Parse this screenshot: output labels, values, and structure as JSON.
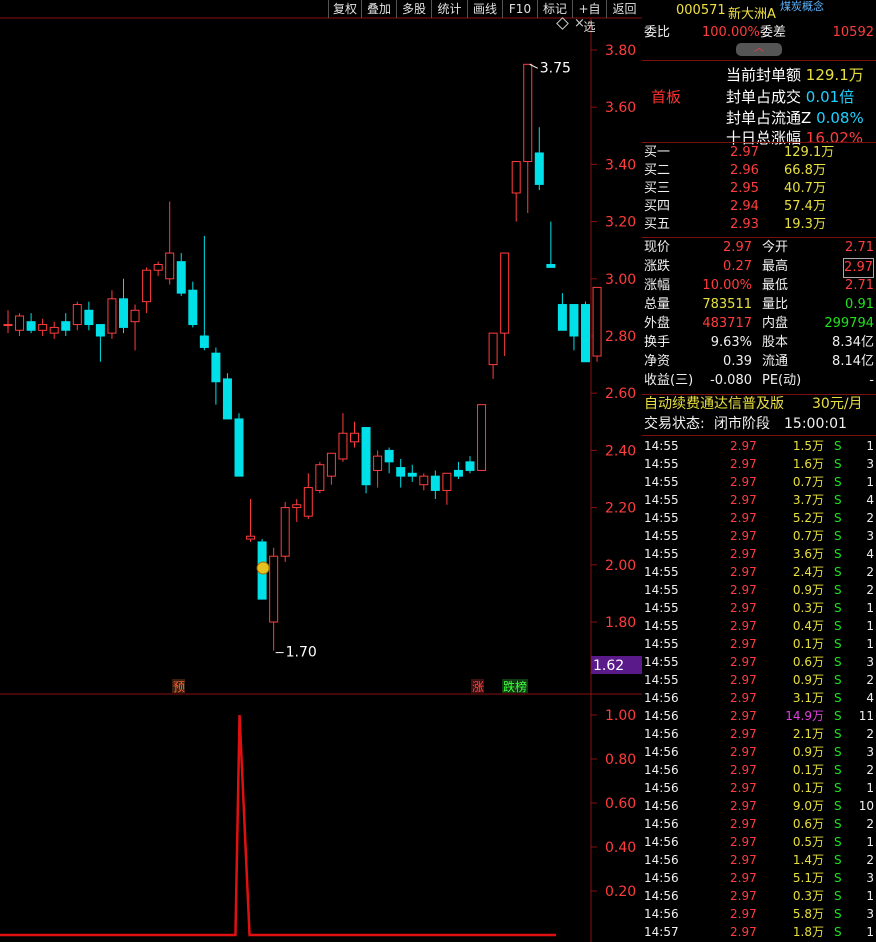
{
  "toolbar": {
    "buttons": [
      "复权",
      "叠加",
      "多股",
      "统计",
      "画线",
      "F10",
      "标记",
      "+自选",
      "返回"
    ]
  },
  "price_axis": {
    "labels": [
      "3.80",
      "3.60",
      "3.40",
      "3.20",
      "3.00",
      "2.80",
      "2.60",
      "2.40",
      "2.20",
      "2.00",
      "1.80"
    ],
    "current_marker": "1.62"
  },
  "annotations": {
    "high_label": "3.75",
    "low_label": "1.70",
    "marker_yu": "预",
    "marker_zhang": "涨",
    "marker_longhubang": "跌榜"
  },
  "indicator_axis": {
    "labels": [
      "1.00",
      "0.80",
      "0.60",
      "0.40",
      "0.20"
    ]
  },
  "chart_data": [
    {
      "type": "candlestick",
      "title": "",
      "ylim": [
        1.62,
        3.85
      ],
      "x_unit": "trading day index",
      "candles": [
        {
          "o": 2.84,
          "h": 2.89,
          "l": 2.81,
          "c": 2.84
        },
        {
          "o": 2.82,
          "h": 2.88,
          "l": 2.8,
          "c": 2.87
        },
        {
          "o": 2.85,
          "h": 2.88,
          "l": 2.81,
          "c": 2.82
        },
        {
          "o": 2.82,
          "h": 2.86,
          "l": 2.8,
          "c": 2.84
        },
        {
          "o": 2.81,
          "h": 2.85,
          "l": 2.79,
          "c": 2.83
        },
        {
          "o": 2.85,
          "h": 2.88,
          "l": 2.8,
          "c": 2.82
        },
        {
          "o": 2.84,
          "h": 2.92,
          "l": 2.82,
          "c": 2.91
        },
        {
          "o": 2.89,
          "h": 2.92,
          "l": 2.82,
          "c": 2.84
        },
        {
          "o": 2.84,
          "h": 2.84,
          "l": 2.71,
          "c": 2.8
        },
        {
          "o": 2.81,
          "h": 2.96,
          "l": 2.79,
          "c": 2.93
        },
        {
          "o": 2.93,
          "h": 3.0,
          "l": 2.81,
          "c": 2.83
        },
        {
          "o": 2.85,
          "h": 2.91,
          "l": 2.75,
          "c": 2.89
        },
        {
          "o": 2.92,
          "h": 3.04,
          "l": 2.88,
          "c": 3.03
        },
        {
          "o": 3.03,
          "h": 3.06,
          "l": 3.01,
          "c": 3.05
        },
        {
          "o": 3.0,
          "h": 3.27,
          "l": 2.98,
          "c": 3.09
        },
        {
          "o": 3.06,
          "h": 3.09,
          "l": 2.94,
          "c": 2.95
        },
        {
          "o": 2.96,
          "h": 2.99,
          "l": 2.83,
          "c": 2.84
        },
        {
          "o": 2.8,
          "h": 3.15,
          "l": 2.75,
          "c": 2.76
        },
        {
          "o": 2.74,
          "h": 2.76,
          "l": 2.56,
          "c": 2.64
        },
        {
          "o": 2.65,
          "h": 2.67,
          "l": 2.53,
          "c": 2.51
        },
        {
          "o": 2.51,
          "h": 2.53,
          "l": 2.31,
          "c": 2.31
        },
        {
          "o": 2.09,
          "h": 2.23,
          "l": 2.08,
          "c": 2.1
        },
        {
          "o": 2.08,
          "h": 2.09,
          "l": 1.88,
          "c": 1.88
        },
        {
          "o": 1.8,
          "h": 2.06,
          "l": 1.7,
          "c": 2.03
        },
        {
          "o": 2.03,
          "h": 2.22,
          "l": 2.01,
          "c": 2.2
        },
        {
          "o": 2.2,
          "h": 2.23,
          "l": 2.15,
          "c": 2.21
        },
        {
          "o": 2.17,
          "h": 2.32,
          "l": 2.16,
          "c": 2.27
        },
        {
          "o": 2.26,
          "h": 2.36,
          "l": 2.25,
          "c": 2.35
        },
        {
          "o": 2.31,
          "h": 2.39,
          "l": 2.28,
          "c": 2.39
        },
        {
          "o": 2.37,
          "h": 2.53,
          "l": 2.36,
          "c": 2.46
        },
        {
          "o": 2.43,
          "h": 2.5,
          "l": 2.41,
          "c": 2.46
        },
        {
          "o": 2.48,
          "h": 2.48,
          "l": 2.25,
          "c": 2.28
        },
        {
          "o": 2.33,
          "h": 2.4,
          "l": 2.27,
          "c": 2.38
        },
        {
          "o": 2.4,
          "h": 2.41,
          "l": 2.32,
          "c": 2.36
        },
        {
          "o": 2.34,
          "h": 2.37,
          "l": 2.27,
          "c": 2.31
        },
        {
          "o": 2.32,
          "h": 2.35,
          "l": 2.29,
          "c": 2.31
        },
        {
          "o": 2.28,
          "h": 2.32,
          "l": 2.26,
          "c": 2.31
        },
        {
          "o": 2.31,
          "h": 2.33,
          "l": 2.23,
          "c": 2.26
        },
        {
          "o": 2.26,
          "h": 2.32,
          "l": 2.21,
          "c": 2.32
        },
        {
          "o": 2.33,
          "h": 2.36,
          "l": 2.3,
          "c": 2.31
        },
        {
          "o": 2.36,
          "h": 2.38,
          "l": 2.32,
          "c": 2.33
        },
        {
          "o": 2.33,
          "h": 2.56,
          "l": 2.33,
          "c": 2.56
        },
        {
          "o": 2.7,
          "h": 2.81,
          "l": 2.65,
          "c": 2.81
        },
        {
          "o": 2.81,
          "h": 3.09,
          "l": 2.73,
          "c": 3.09
        },
        {
          "o": 3.3,
          "h": 3.41,
          "l": 3.2,
          "c": 3.41
        },
        {
          "o": 3.41,
          "h": 3.75,
          "l": 3.23,
          "c": 3.75
        },
        {
          "o": 3.44,
          "h": 3.53,
          "l": 3.31,
          "c": 3.33
        },
        {
          "o": 3.05,
          "h": 3.2,
          "l": 3.04,
          "c": 3.04
        },
        {
          "o": 2.91,
          "h": 2.95,
          "l": 2.82,
          "c": 2.82
        },
        {
          "o": 2.91,
          "h": 2.91,
          "l": 2.75,
          "c": 2.8
        },
        {
          "o": 2.91,
          "h": 2.92,
          "l": 2.71,
          "c": 2.71
        },
        {
          "o": 2.73,
          "h": 2.97,
          "l": 2.71,
          "c": 2.97
        }
      ]
    },
    {
      "type": "line",
      "title": "",
      "ylim": [
        0,
        1.1
      ],
      "x_unit": "trading day index",
      "series": [
        {
          "name": "",
          "points": [
            [
              0,
              0
            ],
            [
              19,
              0
            ],
            [
              20,
              1.0
            ],
            [
              21,
              0
            ],
            [
              51,
              0
            ]
          ]
        }
      ]
    }
  ],
  "panel": {
    "code": "000571",
    "name": "新大洲A",
    "concept": "煤炭概念",
    "weibi_label": "委比",
    "weibi_value": "100.00%",
    "weicha_label": "委差",
    "weicha_value": "10592",
    "expand_icon": "chevron-up-icon",
    "first_board": "首板",
    "seal_amount_label": "当前封单额",
    "seal_amount_value": "129.1万",
    "seal_vs_turnover_label": "封单占成交",
    "seal_vs_turnover_value": "0.01倍",
    "seal_vs_float_label": "封单占流通Z",
    "seal_vs_float_value": "0.08%",
    "ten_day_label": "十日总涨幅",
    "ten_day_value": "16.02%",
    "bids": [
      {
        "label": "买一",
        "price": "2.97",
        "vol": "129.1万"
      },
      {
        "label": "买二",
        "price": "2.96",
        "vol": "66.8万"
      },
      {
        "label": "买三",
        "price": "2.95",
        "vol": "40.7万"
      },
      {
        "label": "买四",
        "price": "2.94",
        "vol": "57.4万"
      },
      {
        "label": "买五",
        "price": "2.93",
        "vol": "19.3万"
      }
    ],
    "stats": [
      {
        "l1": "现价",
        "v1": "2.97",
        "l2": "今开",
        "v2": "2.71"
      },
      {
        "l1": "涨跌",
        "v1": "0.27",
        "l2": "最高",
        "v2": "2.97"
      },
      {
        "l1": "涨幅",
        "v1": "10.00%",
        "l2": "最低",
        "v2": "2.71"
      },
      {
        "l1": "总量",
        "v1": "783511",
        "l2": "量比",
        "v2": "0.91"
      },
      {
        "l1": "外盘",
        "v1": "483717",
        "l2": "内盘",
        "v2": "299794"
      },
      {
        "l1": "换手",
        "v1": "9.63%",
        "l2": "股本",
        "v2": "8.34亿"
      },
      {
        "l1": "净资",
        "v1": "0.39",
        "l2": "流通",
        "v2": "8.14亿"
      },
      {
        "l1": "收益(三)",
        "v1": "-0.080",
        "l2": "PE(动)",
        "v2": "-"
      }
    ],
    "subscription_text": "自动续费通达信普及版",
    "subscription_price": "30元/月",
    "trade_status_label": "交易状态:",
    "trade_status_value": "闭市阶段",
    "trade_status_time": "15:00:01",
    "ticks": [
      {
        "t": "14:55",
        "p": "2.97",
        "v": "1.5万",
        "s": "S",
        "n": "1"
      },
      {
        "t": "14:55",
        "p": "2.97",
        "v": "1.6万",
        "s": "S",
        "n": "3"
      },
      {
        "t": "14:55",
        "p": "2.97",
        "v": "0.7万",
        "s": "S",
        "n": "1"
      },
      {
        "t": "14:55",
        "p": "2.97",
        "v": "3.7万",
        "s": "S",
        "n": "4"
      },
      {
        "t": "14:55",
        "p": "2.97",
        "v": "5.2万",
        "s": "S",
        "n": "2"
      },
      {
        "t": "14:55",
        "p": "2.97",
        "v": "0.7万",
        "s": "S",
        "n": "3"
      },
      {
        "t": "14:55",
        "p": "2.97",
        "v": "3.6万",
        "s": "S",
        "n": "4"
      },
      {
        "t": "14:55",
        "p": "2.97",
        "v": "2.4万",
        "s": "S",
        "n": "2"
      },
      {
        "t": "14:55",
        "p": "2.97",
        "v": "0.9万",
        "s": "S",
        "n": "2"
      },
      {
        "t": "14:55",
        "p": "2.97",
        "v": "0.3万",
        "s": "S",
        "n": "1"
      },
      {
        "t": "14:55",
        "p": "2.97",
        "v": "0.4万",
        "s": "S",
        "n": "1"
      },
      {
        "t": "14:55",
        "p": "2.97",
        "v": "0.1万",
        "s": "S",
        "n": "1"
      },
      {
        "t": "14:55",
        "p": "2.97",
        "v": "0.6万",
        "s": "S",
        "n": "3"
      },
      {
        "t": "14:55",
        "p": "2.97",
        "v": "0.9万",
        "s": "S",
        "n": "2"
      },
      {
        "t": "14:56",
        "p": "2.97",
        "v": "3.1万",
        "s": "S",
        "n": "4"
      },
      {
        "t": "14:56",
        "p": "2.97",
        "v": "14.9万",
        "s": "S",
        "n": "11"
      },
      {
        "t": "14:56",
        "p": "2.97",
        "v": "2.1万",
        "s": "S",
        "n": "2"
      },
      {
        "t": "14:56",
        "p": "2.97",
        "v": "0.9万",
        "s": "S",
        "n": "3"
      },
      {
        "t": "14:56",
        "p": "2.97",
        "v": "0.1万",
        "s": "S",
        "n": "2"
      },
      {
        "t": "14:56",
        "p": "2.97",
        "v": "0.1万",
        "s": "S",
        "n": "1"
      },
      {
        "t": "14:56",
        "p": "2.97",
        "v": "9.0万",
        "s": "S",
        "n": "10"
      },
      {
        "t": "14:56",
        "p": "2.97",
        "v": "0.6万",
        "s": "S",
        "n": "2"
      },
      {
        "t": "14:56",
        "p": "2.97",
        "v": "0.5万",
        "s": "S",
        "n": "1"
      },
      {
        "t": "14:56",
        "p": "2.97",
        "v": "1.4万",
        "s": "S",
        "n": "2"
      },
      {
        "t": "14:56",
        "p": "2.97",
        "v": "5.1万",
        "s": "S",
        "n": "3"
      },
      {
        "t": "14:56",
        "p": "2.97",
        "v": "0.3万",
        "s": "S",
        "n": "1"
      },
      {
        "t": "14:56",
        "p": "2.97",
        "v": "5.8万",
        "s": "S",
        "n": "3"
      },
      {
        "t": "14:57",
        "p": "2.97",
        "v": "1.8万",
        "s": "S",
        "n": "1"
      }
    ],
    "colors": {
      "up": "#ff3d3d",
      "down": "#00e0e8",
      "border": "#7a1010",
      "indicator_line": "#e01010"
    }
  }
}
